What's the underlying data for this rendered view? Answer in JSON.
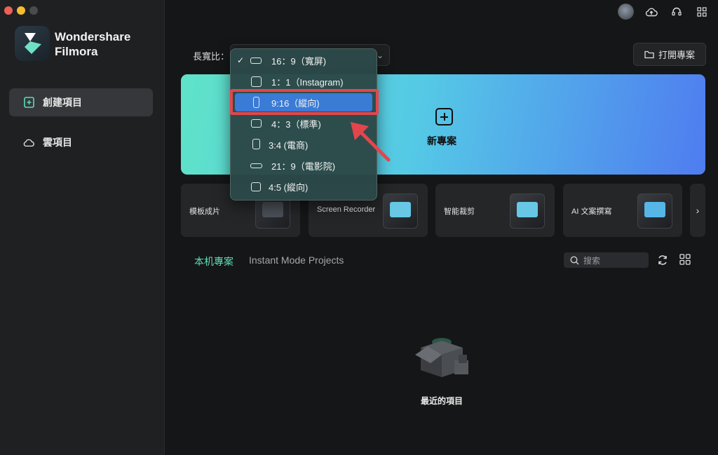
{
  "sidebar": {
    "brand_line1": "Wondershare",
    "brand_line2": "Filmora",
    "items": [
      {
        "label": "創建項目",
        "icon": "add-file-icon",
        "active": true
      },
      {
        "label": "雲項目",
        "icon": "cloud-icon",
        "active": false
      }
    ]
  },
  "topbar": {
    "icons": [
      "avatar",
      "cloud-upload-icon",
      "headset-icon",
      "apps-grid-icon"
    ]
  },
  "aspect": {
    "label": "長寬比："
  },
  "open_project": {
    "label": "打開專案"
  },
  "hero": {
    "new_project": "新專案"
  },
  "dropdown": {
    "options": [
      {
        "label": "16：9（寬屏)",
        "checked": true,
        "selected": false
      },
      {
        "label": "1：1（Instagram)",
        "checked": false,
        "selected": false
      },
      {
        "label": "9:16（縱向)",
        "checked": false,
        "selected": true
      },
      {
        "label": "4：3（標準)",
        "checked": false,
        "selected": false
      },
      {
        "label": "3:4 (電商)",
        "checked": false,
        "selected": false
      },
      {
        "label": "21：9（電影院)",
        "checked": false,
        "selected": false
      },
      {
        "label": "4:5 (縱向)",
        "checked": false,
        "selected": false
      }
    ],
    "highlight_color": "#e2464c",
    "selected_color": "#3a7bd5"
  },
  "cards": [
    {
      "label": "模板成片"
    },
    {
      "label": "Screen Recorder"
    },
    {
      "label": "智能裁剪"
    },
    {
      "label": "AI 文案撰寫"
    }
  ],
  "tabs": {
    "local": "本机專案",
    "instant": "Instant Mode Projects"
  },
  "search": {
    "placeholder": "搜索"
  },
  "empty": {
    "label": "最近的項目"
  },
  "colors": {
    "accent": "#5fdcb8",
    "banner_start": "#5fe3c8",
    "banner_end": "#4f7cf0"
  }
}
